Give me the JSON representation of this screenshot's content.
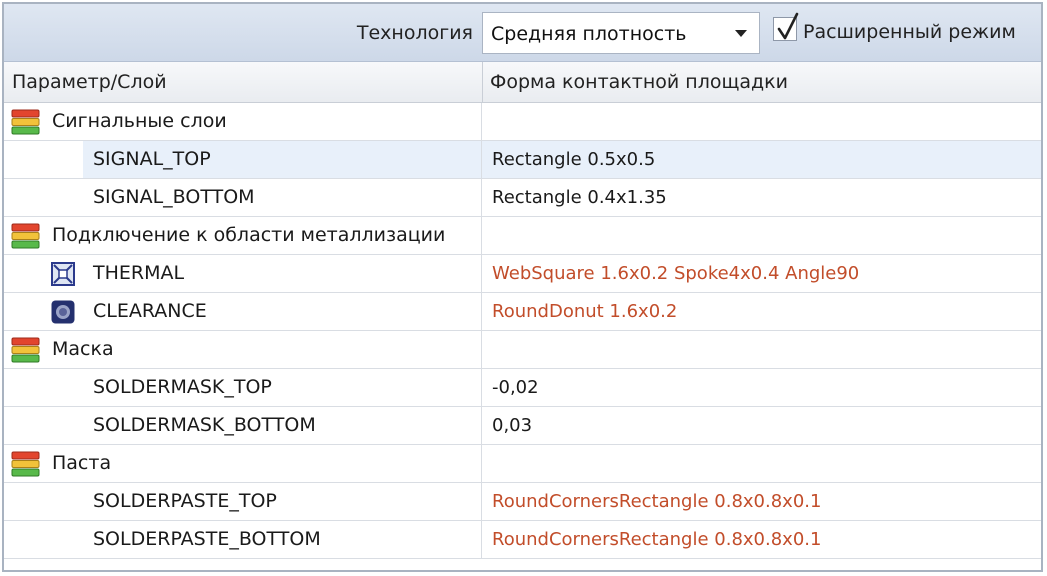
{
  "toolbar": {
    "technology_label": "Технология",
    "technology_value": "Средняя плотность",
    "advanced_mode_label": "Расширенный режим",
    "advanced_mode_checked": true
  },
  "grid": {
    "columns": [
      "Параметр/Слой",
      "Форма контактной площадки"
    ],
    "groups": [
      {
        "label": "Сигнальные слои",
        "icon": "layers-group-icon",
        "rows": [
          {
            "name": "SIGNAL_TOP",
            "value": "Rectangle 0.5x0.5",
            "value_color": "dark",
            "icon": "",
            "selected": true
          },
          {
            "name": "SIGNAL_BOTTOM",
            "value": "Rectangle 0.4x1.35",
            "value_color": "dark",
            "icon": ""
          }
        ]
      },
      {
        "label": "Подключение к области металлизации",
        "icon": "layers-group-icon",
        "rows": [
          {
            "name": "THERMAL",
            "value": "WebSquare 1.6x0.2 Spoke4x0.4 Angle90",
            "value_color": "red",
            "icon": "thermal-pad-icon"
          },
          {
            "name": "CLEARANCE",
            "value": "RoundDonut 1.6x0.2",
            "value_color": "red",
            "icon": "clearance-pad-icon"
          }
        ]
      },
      {
        "label": "Маска",
        "icon": "layers-group-icon",
        "rows": [
          {
            "name": "SOLDERMASK_TOP",
            "value": "-0,02",
            "value_color": "dark",
            "icon": ""
          },
          {
            "name": "SOLDERMASK_BOTTOM",
            "value": "0,03",
            "value_color": "dark",
            "icon": ""
          }
        ]
      },
      {
        "label": "Паста",
        "icon": "layers-group-icon",
        "rows": [
          {
            "name": "SOLDERPASTE_TOP",
            "value": "RoundCornersRectangle 0.8x0.8x0.1",
            "value_color": "red",
            "icon": ""
          },
          {
            "name": "SOLDERPASTE_BOTTOM",
            "value": "RoundCornersRectangle 0.8x0.8x0.1",
            "value_color": "red",
            "icon": ""
          }
        ]
      }
    ]
  },
  "colors": {
    "value_dark": "#1a1a1a",
    "value_red": "#c24d2a",
    "selected_row": "#e8f0fa",
    "toolbar_bg": "#d6e0ee"
  }
}
